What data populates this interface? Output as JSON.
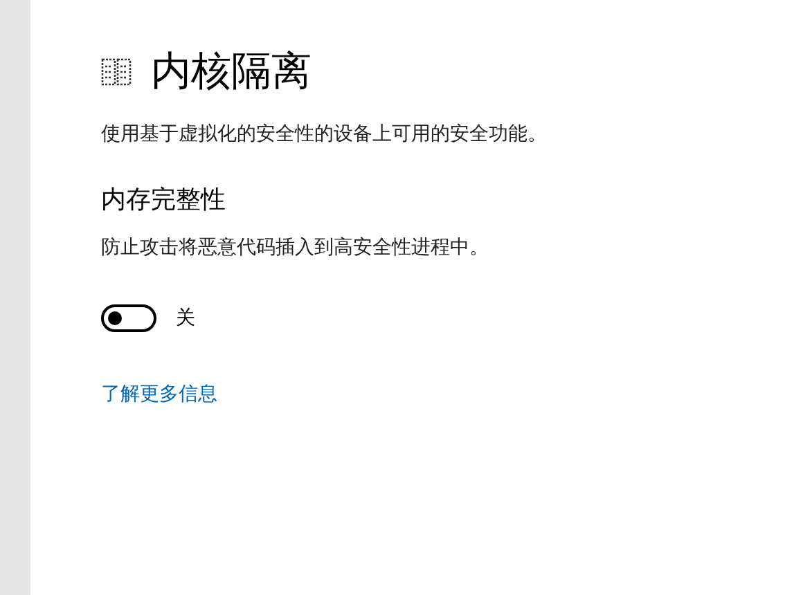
{
  "page": {
    "title": "内核隔离",
    "description": "使用基于虚拟化的安全性的设备上可用的安全功能。"
  },
  "section": {
    "title": "内存完整性",
    "description": "防止攻击将恶意代码插入到高安全性进程中。"
  },
  "toggle": {
    "on": false,
    "label": "关"
  },
  "link": "了解更多信息"
}
